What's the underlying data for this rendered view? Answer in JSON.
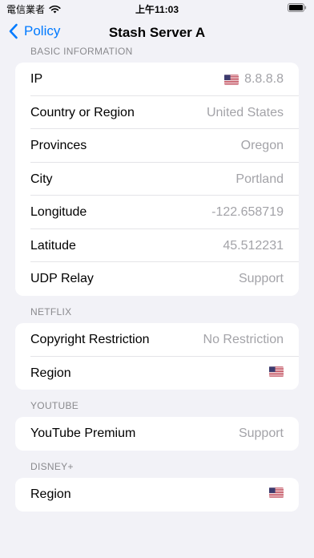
{
  "status_bar": {
    "carrier": "電信業者",
    "time": "上午11:03"
  },
  "nav": {
    "back_label": "Policy",
    "title": "Stash Server A"
  },
  "sections": {
    "basic": {
      "header": "BASIC INFORMATION",
      "ip_label": "IP",
      "ip_value": "8.8.8.8",
      "country_label": "Country or Region",
      "country_value": "United States",
      "province_label": "Provinces",
      "province_value": "Oregon",
      "city_label": "City",
      "city_value": "Portland",
      "longitude_label": "Longitude",
      "longitude_value": "-122.658719",
      "latitude_label": "Latitude",
      "latitude_value": "45.512231",
      "udp_label": "UDP Relay",
      "udp_value": "Support"
    },
    "netflix": {
      "header": "NETFLIX",
      "copyright_label": "Copyright Restriction",
      "copyright_value": "No Restriction",
      "region_label": "Region"
    },
    "youtube": {
      "header": "YOUTUBE",
      "premium_label": "YouTube Premium",
      "premium_value": "Support"
    },
    "disney": {
      "header": "DISNEY+",
      "region_label": "Region"
    }
  },
  "icons": {
    "flag": "us-flag-icon",
    "back": "chevron-back-icon",
    "wifi": "wifi-icon",
    "battery": "battery-icon"
  },
  "colors": {
    "accent": "#007aff",
    "background": "#f2f2f7",
    "secondary_text": "#a3a3a8",
    "section_header": "#8a8a8e"
  }
}
